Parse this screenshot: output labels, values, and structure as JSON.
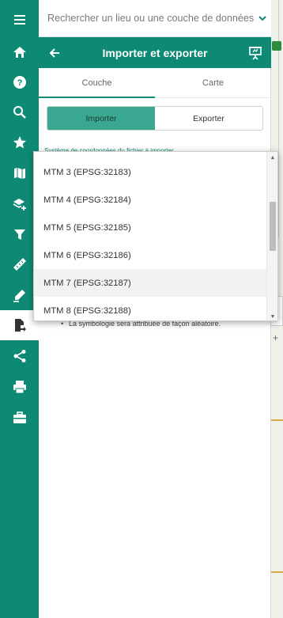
{
  "search": {
    "placeholder": "Rechercher un lieu ou une couche de données"
  },
  "panel": {
    "title": "Importer et exporter",
    "tabs": [
      {
        "label": "Couche",
        "active": true
      },
      {
        "label": "Carte",
        "active": false
      }
    ],
    "mode": {
      "import_label": "Importer",
      "export_label": "Exporter",
      "selected": "Importer"
    },
    "coord_label": "Système de coordonnées du fichier à importer",
    "note": "La symbologie sera attribuée de façon aléatoire."
  },
  "dropdown": {
    "options": [
      "MTM 3 (EPSG:32183)",
      "MTM 4 (EPSG:32184)",
      "MTM 5 (EPSG:32185)",
      "MTM 6 (EPSG:32186)",
      "MTM 7 (EPSG:32187)",
      "MTM 8 (EPSG:32188)"
    ],
    "highlighted": "MTM 7 (EPSG:32187)"
  },
  "sidebar": {
    "items": [
      {
        "icon": "menu-icon"
      },
      {
        "icon": "home-icon"
      },
      {
        "icon": "help-icon"
      },
      {
        "icon": "search-icon"
      },
      {
        "icon": "star-icon"
      },
      {
        "icon": "map-icon"
      },
      {
        "icon": "add-layer-icon"
      },
      {
        "icon": "filter-icon"
      },
      {
        "icon": "ruler-icon"
      },
      {
        "icon": "draw-icon"
      },
      {
        "icon": "import-export-icon",
        "active": true
      },
      {
        "icon": "share-icon"
      },
      {
        "icon": "print-icon"
      },
      {
        "icon": "toolbox-icon"
      }
    ]
  },
  "colors": {
    "primary": "#0e8a74",
    "toggle_active": "#3aa891",
    "highlight_row": "#f2f2f2"
  }
}
